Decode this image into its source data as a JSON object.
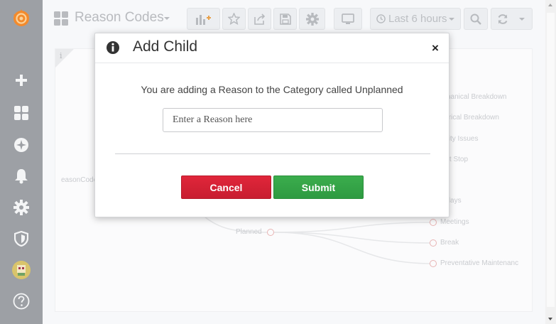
{
  "dashboard": {
    "title": "Reason Codes",
    "time_range": "Last 6 hours"
  },
  "tree": {
    "root_label": "easonCode",
    "mid_label": "Planned",
    "leaves": [
      "chanical Breakdown",
      "ctrical Breakdown",
      "ality Issues",
      "ort Stop",
      "lidays",
      "Meetings",
      "Break",
      "Preventative Maintenanc"
    ]
  },
  "modal": {
    "title": "Add Child",
    "close_glyph": "×",
    "message": "You are adding a Reason to the Category called Unplanned",
    "input_placeholder": "Enter a Reason here",
    "input_value": "",
    "cancel_label": "Cancel",
    "submit_label": "Submit"
  },
  "panel": {
    "info_glyph": "i"
  },
  "colors": {
    "sidebar_bg": "#9da0a5",
    "cancel": "#d42235",
    "submit": "#33a347",
    "node_stroke": "#e8b4b4"
  },
  "icons": {
    "sidebar": [
      "grafana-logo-icon",
      "plus-icon",
      "dashboards-icon",
      "explore-icon",
      "bell-icon",
      "gear-icon",
      "shield-icon",
      "user-avatar-icon",
      "help-icon"
    ],
    "toolbar": [
      "add-panel-icon",
      "star-icon",
      "share-icon",
      "save-icon",
      "settings-icon",
      "tv-icon",
      "clock-icon",
      "search-icon",
      "refresh-icon",
      "caret-down-icon"
    ]
  }
}
